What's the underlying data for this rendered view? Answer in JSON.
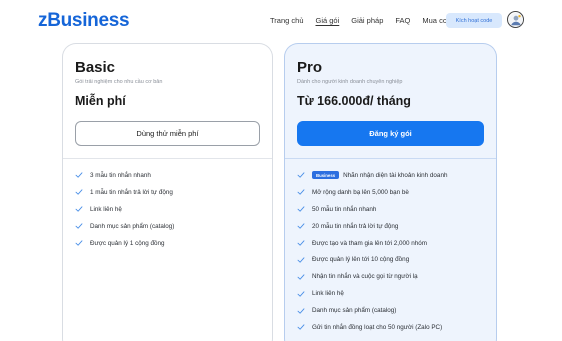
{
  "header": {
    "logo": "zBusiness",
    "nav": [
      "Trang chủ",
      "Giá gói",
      "Giải pháp",
      "FAQ",
      "Mua code"
    ],
    "active_nav": "Giá gói",
    "activate_button": "Kích hoạt code",
    "avatar_icon": "user-avatar-icon"
  },
  "plans": {
    "basic": {
      "title": "Basic",
      "subtitle": "Gói trải nghiệm cho nhu cầu cơ bản",
      "price": "Miễn phí",
      "cta": "Dùng thử miễn phí",
      "features": [
        "3 mẫu tin nhắn nhanh",
        "1 mẫu tin nhắn trả lời tự động",
        "Link liên hệ",
        "Danh mục sản phẩm (catalog)",
        "Được quản lý 1 cộng đồng"
      ]
    },
    "pro": {
      "title": "Pro",
      "subtitle": "Dành cho người kinh doanh chuyên nghiệp",
      "price": "Từ 166.000đ/ tháng",
      "cta": "Đăng ký gói",
      "badge": "Business",
      "features": [
        "Nhãn nhận diện tài khoản kinh doanh",
        "Mở rộng danh bạ lên 5,000 bạn bè",
        "50 mẫu tin nhắn nhanh",
        "20 mẫu tin nhắn trả lời tự động",
        "Được tạo và tham gia lên tới 2,000 nhóm",
        "Được quản lý lên tới 10 cộng đồng",
        "Nhận tin nhắn và cuộc gọi từ người lạ",
        "Link liên hệ",
        "Danh mục sản phẩm (catalog)",
        "Gửi tin nhắn đồng loạt cho 50 người (Zalo PC)"
      ]
    }
  },
  "colors": {
    "brand": "#1565d8",
    "primary_button": "#1677f0",
    "check": "#4a8fe7",
    "pro_background": "#eef4fd"
  }
}
